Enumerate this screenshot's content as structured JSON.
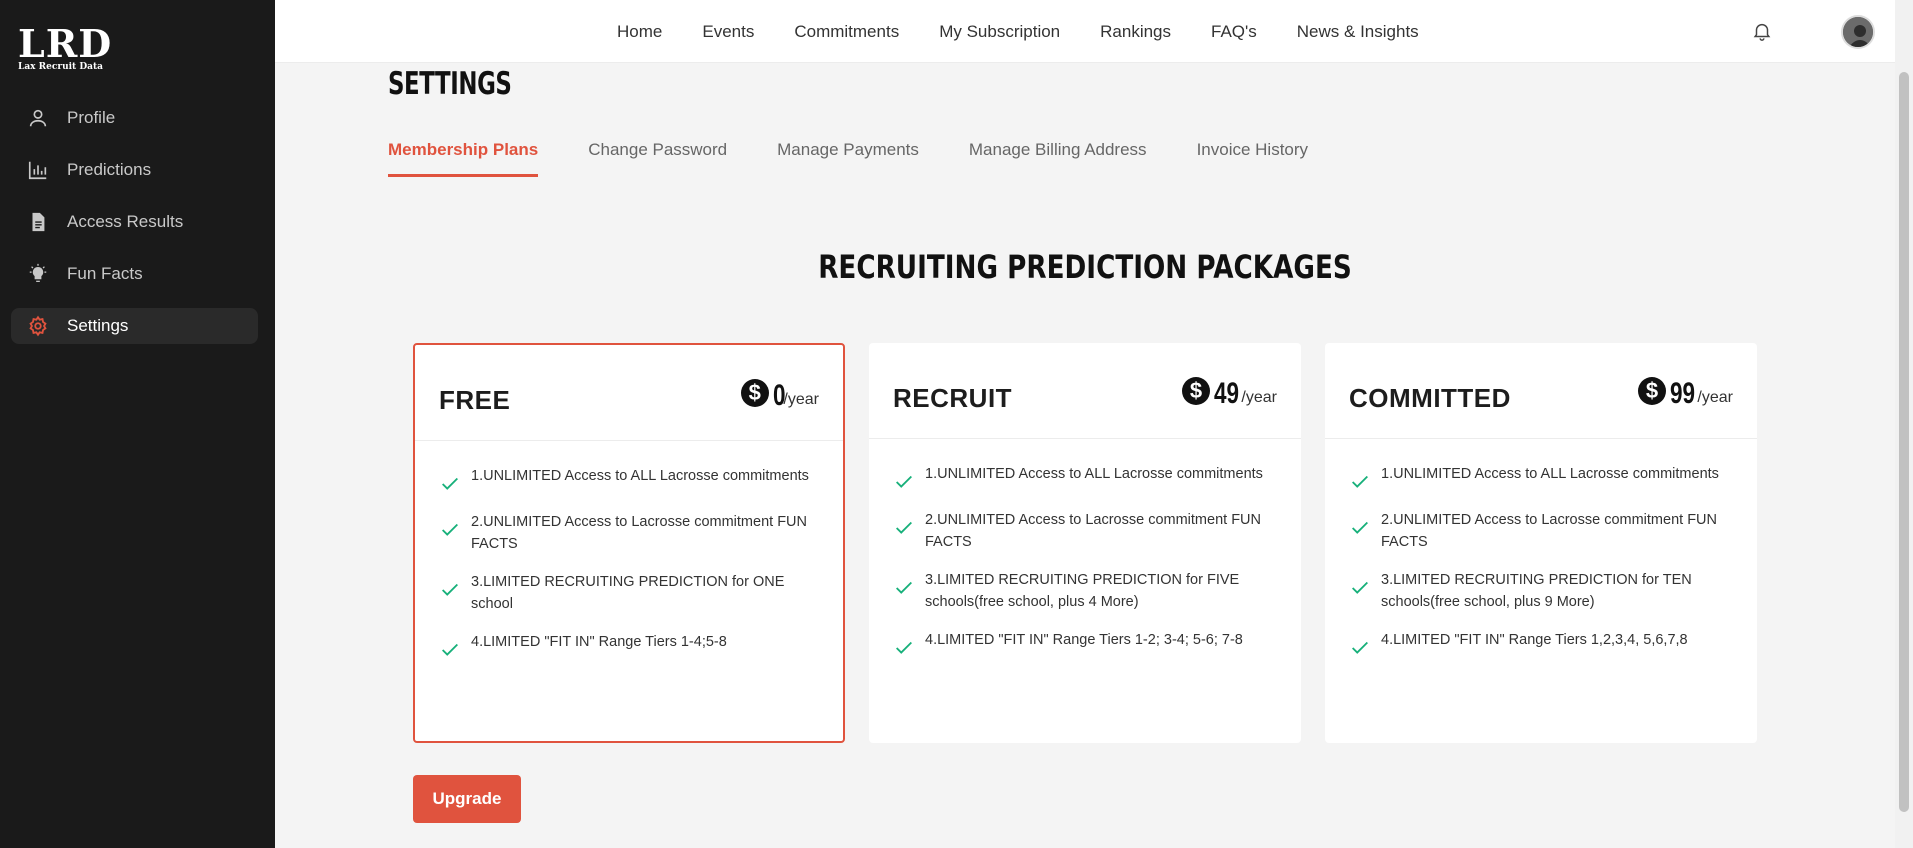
{
  "brand": {
    "logo_text": "LRD",
    "logo_subtitle": "Lax Recruit Data"
  },
  "sidebar": {
    "items": [
      {
        "label": "Profile",
        "icon": "user-icon"
      },
      {
        "label": "Predictions",
        "icon": "bar-chart-icon"
      },
      {
        "label": "Access Results",
        "icon": "document-icon"
      },
      {
        "label": "Fun Facts",
        "icon": "lightbulb-icon"
      },
      {
        "label": "Settings",
        "icon": "gear-icon",
        "active": true
      }
    ]
  },
  "topnav": {
    "links": [
      "Home",
      "Events",
      "Commitments",
      "My Subscription",
      "Rankings",
      "FAQ's",
      "News & Insights"
    ]
  },
  "page": {
    "title": "SETTINGS"
  },
  "tabs": [
    "Membership Plans",
    "Change Password",
    "Manage Payments",
    "Manage Billing Address",
    "Invoice History"
  ],
  "packages": {
    "title": "RECRUITING PREDICTION PACKAGES",
    "plans": [
      {
        "name": "FREE",
        "price": "0",
        "period": "/year",
        "selected": true,
        "features": [
          "1.UNLIMITED Access to ALL Lacrosse commitments",
          "2.UNLIMITED Access to Lacrosse commitment FUN FACTS",
          "3.LIMITED RECRUITING PREDICTION for ONE school",
          "4.LIMITED \"FIT IN\" Range Tiers 1-4;5-8"
        ]
      },
      {
        "name": "RECRUIT",
        "price": "49",
        "period": "/year",
        "selected": false,
        "features": [
          "1.UNLIMITED Access to ALL Lacrosse commitments",
          "2.UNLIMITED Access to Lacrosse commitment FUN FACTS",
          "3.LIMITED RECRUITING PREDICTION for FIVE schools(free school, plus 4 More)",
          "4.LIMITED \"FIT IN\" Range Tiers 1-2; 3-4; 5-6; 7-8"
        ]
      },
      {
        "name": "COMMITTED",
        "price": "99",
        "period": "/year",
        "selected": false,
        "features": [
          "1.UNLIMITED Access to ALL Lacrosse commitments",
          "2.UNLIMITED Access to Lacrosse commitment FUN FACTS",
          "3.LIMITED RECRUITING PREDICTION for TEN schools(free school, plus 9 More)",
          "4.LIMITED \"FIT IN\" Range Tiers 1,2,3,4, 5,6,7,8"
        ]
      }
    ],
    "upgrade_label": "Upgrade"
  },
  "colors": {
    "accent": "#e0533e",
    "check": "#17b07a",
    "sidebar_bg": "#1a1a1a"
  }
}
